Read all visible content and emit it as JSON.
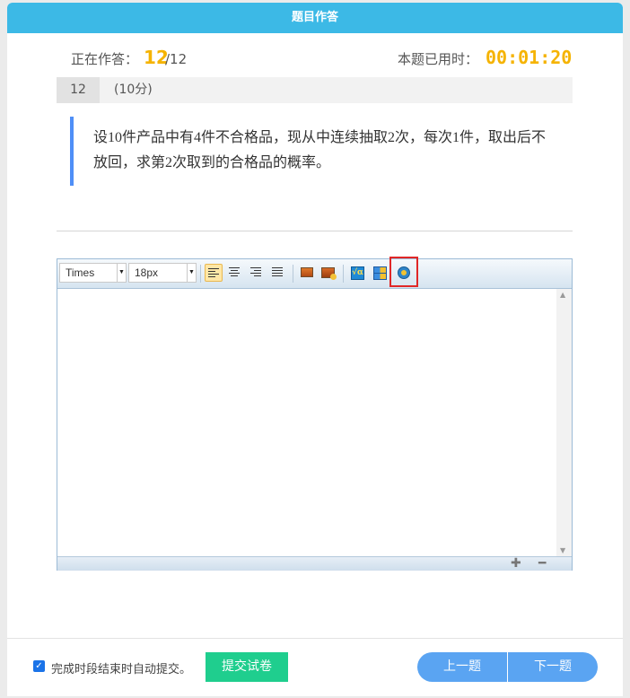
{
  "header": {
    "title": "题目作答"
  },
  "progress": {
    "label": "正在作答：",
    "current": "12",
    "total": "/12"
  },
  "timer": {
    "label": "本题已用时：",
    "value": "00:01:20"
  },
  "question": {
    "number": "12",
    "score": "(10分)",
    "text": "设10件产品中有4件不合格品，现从中连续抽取2次，每次1件，取出后不放回，求第2次取到的合格品的概率。"
  },
  "editor": {
    "font_family": "Times",
    "font_size": "18px",
    "toolbar_icons": [
      "align-left-icon",
      "align-center-icon",
      "align-right-icon",
      "align-justify-icon",
      "image-icon",
      "image-upload-icon",
      "formula-icon",
      "table-icon",
      "record-icon"
    ],
    "accent_highlight": "#e02727"
  },
  "footer": {
    "auto_submit_label": "完成时段结束时自动提交。",
    "auto_submit_checked": true,
    "submit_label": "提交试卷",
    "prev_label": "上一题",
    "next_label": "下一题"
  },
  "colors": {
    "header": "#3cb9e6",
    "accent_number": "#f5b300",
    "submit": "#1fce8e",
    "nav": "#5aa4f2",
    "quote_bar": "#4f8ff7"
  }
}
